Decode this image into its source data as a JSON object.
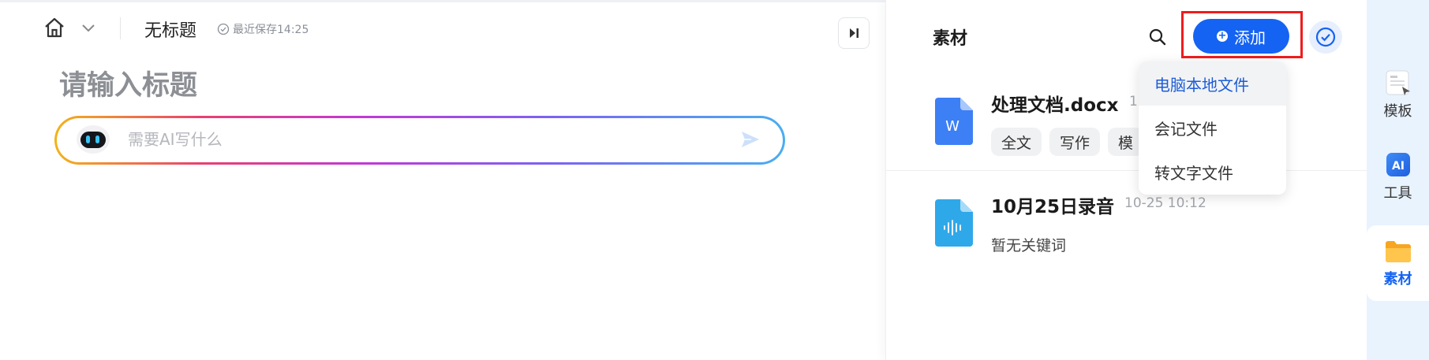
{
  "colors": {
    "accent": "#1463f3",
    "highlight_border": "#ef1c1c",
    "rail_bg": "#e9f3fe"
  },
  "header": {
    "home_icon": "home-icon",
    "title": "无标题",
    "save_status": "最近保存14:25"
  },
  "editor": {
    "heading_placeholder": "请输入标题",
    "ai_input_placeholder": "需要AI写什么"
  },
  "panel": {
    "title": "素材",
    "add_label": "添加",
    "files": [
      {
        "name": "处理文档.docx",
        "time": "1",
        "tags": [
          "全文",
          "写作",
          "模"
        ],
        "icon": "word-doc-icon"
      },
      {
        "name": "10月25日录音",
        "time": "10-25 10:12",
        "keywords": "暂无关键词",
        "icon": "audio-file-icon"
      }
    ],
    "add_menu": [
      "电脑本地文件",
      "会记文件",
      "转文字文件"
    ]
  },
  "rail": {
    "items": [
      {
        "label": "模板",
        "icon": "template-icon"
      },
      {
        "label": "工具",
        "icon": "ai-tool-icon",
        "icon_text": "AI"
      },
      {
        "label": "素材",
        "icon": "folder-icon",
        "active": true
      }
    ]
  }
}
